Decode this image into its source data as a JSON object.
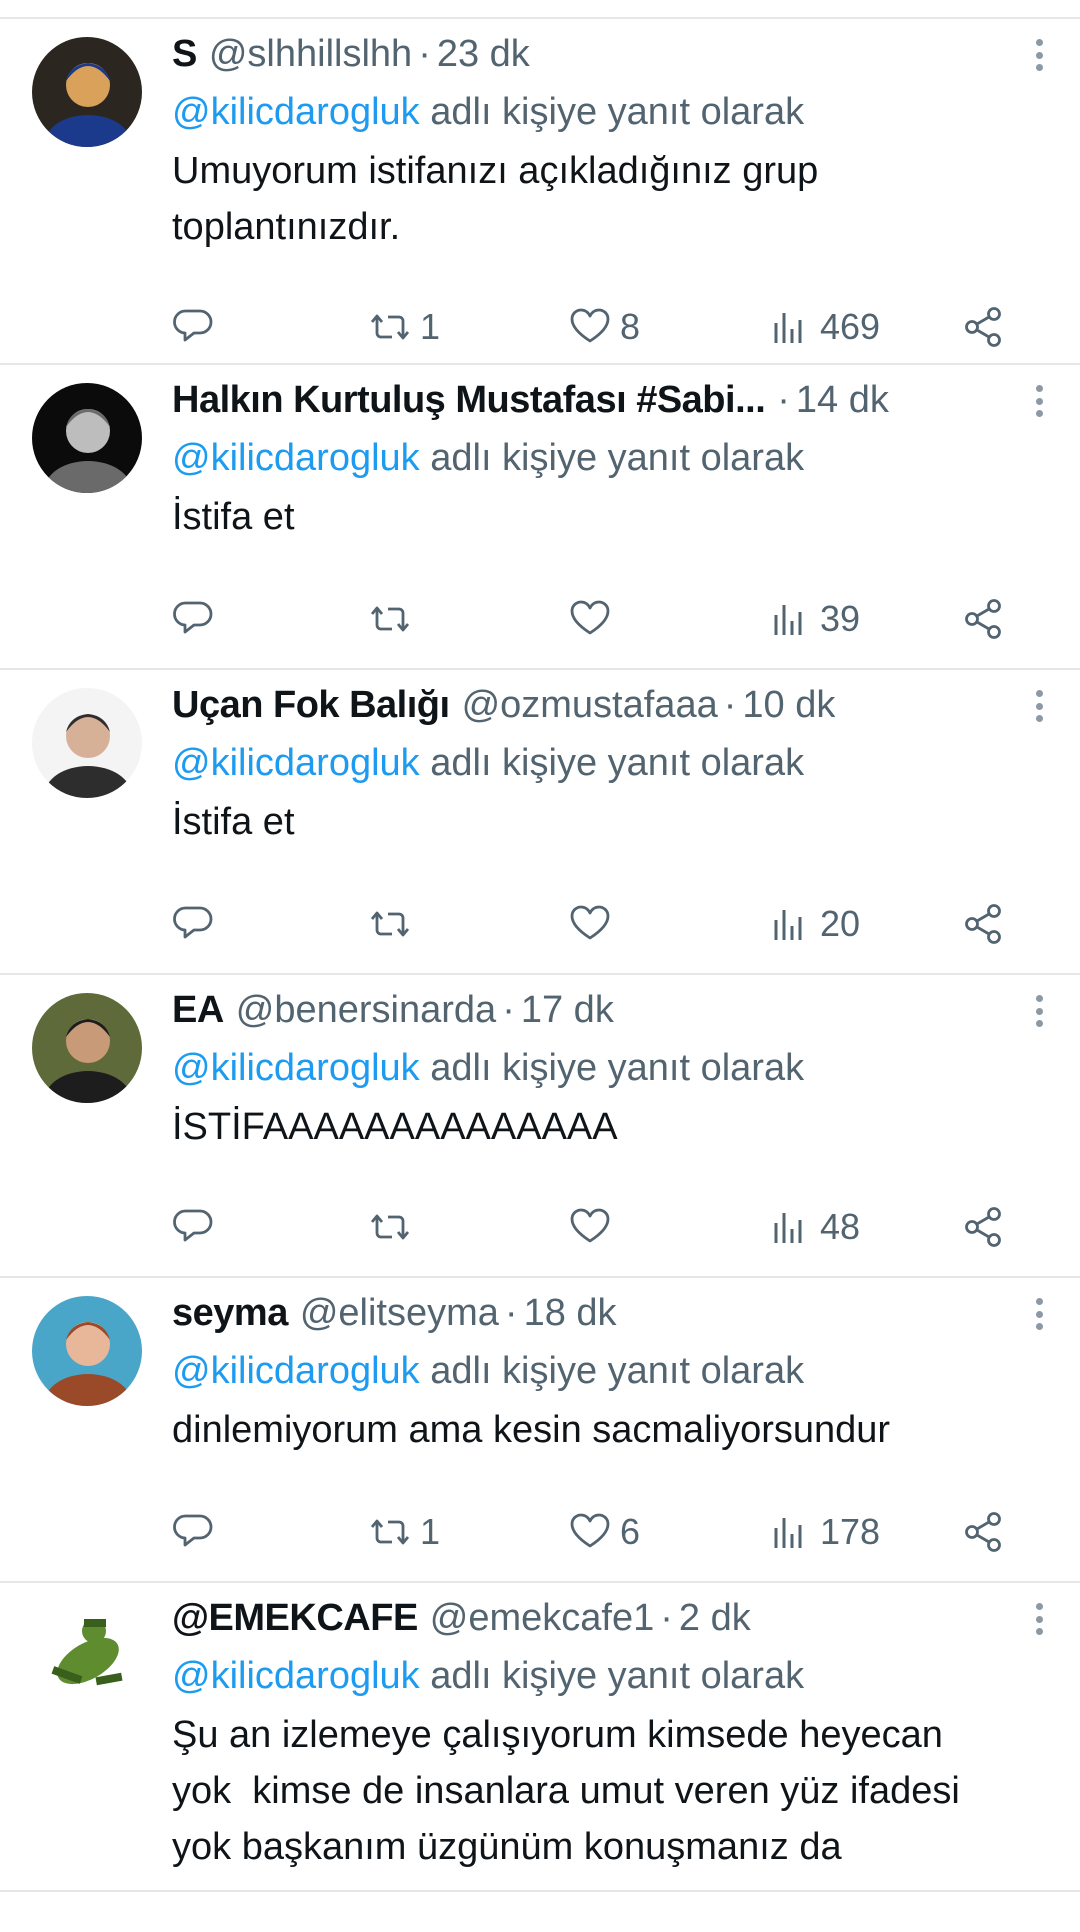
{
  "reply_prefix_suffix": "adlı kişiye yanıt olarak",
  "tweets": [
    {
      "display_name": "S",
      "handle": "@slhhillslhh",
      "separator": "·",
      "time": "23 dk",
      "mention": "@kilicdarogluk",
      "text": "Umuyorum istifanızı açıkladığınız grup\ntoplantınızdır.",
      "replies": "",
      "retweets": "1",
      "likes": "8",
      "views": "469",
      "avatar_colors": [
        "#2b2620",
        "#d9a15a",
        "#1b3a8c"
      ]
    },
    {
      "display_name": "Halkın Kurtuluş Mustafası #Sabi...",
      "handle": "",
      "separator": "·",
      "time": "14 dk",
      "mention": "@kilicdarogluk",
      "text": "İstifa et",
      "replies": "",
      "retweets": "",
      "likes": "",
      "views": "39",
      "avatar_colors": [
        "#0b0b0b",
        "#bdbdbd",
        "#6a6a6a"
      ]
    },
    {
      "display_name": "Uçan Fok Balığı",
      "handle": "@ozmustafaaa",
      "separator": "·",
      "time": "10 dk",
      "mention": "@kilicdarogluk",
      "text": "İstifa et",
      "replies": "",
      "retweets": "",
      "likes": "",
      "views": "20",
      "avatar_colors": [
        "#f4f4f4",
        "#d7b197",
        "#2d2d2d"
      ]
    },
    {
      "display_name": "EA",
      "handle": "@benersinarda",
      "separator": "·",
      "time": "17 dk",
      "mention": "@kilicdarogluk",
      "text": "İSTİFAAAAAAAAAAAAAA",
      "replies": "",
      "retweets": "",
      "likes": "",
      "views": "48",
      "avatar_colors": [
        "#5f6a3a",
        "#c99a78",
        "#1d1d1d"
      ]
    },
    {
      "display_name": "seyma",
      "handle": "@elitseyma",
      "separator": "·",
      "time": "18 dk",
      "mention": "@kilicdarogluk",
      "text": "dinlemiyorum ama kesin sacmaliyorsundur",
      "replies": "",
      "retweets": "1",
      "likes": "6",
      "views": "178",
      "avatar_colors": [
        "#4aa6c9",
        "#e8b79a",
        "#9a4a28"
      ]
    },
    {
      "display_name": "@EMEKCAFE",
      "handle": "@emekcafe1",
      "separator": "·",
      "time": "2 dk",
      "mention": "@kilicdarogluk",
      "text": "Şu an izlemeye çalışıyorum kimsede heyecan\nyok  kimse de insanlara umut veren yüz ifadesi\nyok başkanım üzgünüm konuşmanız da",
      "replies": "",
      "retweets": "",
      "likes": "",
      "views": "",
      "avatar_colors": [
        "#ffffff",
        "#5e8c2f",
        "#3a5f1c"
      ]
    }
  ],
  "icons": {
    "reply": "reply-icon",
    "retweet": "retweet-icon",
    "like": "like-icon",
    "views": "views-icon",
    "share": "share-icon",
    "more": "more-icon"
  },
  "colors": {
    "text": "#0f1419",
    "secondary": "#536471",
    "link": "#1d9bf0",
    "divider": "#e4e7ea"
  }
}
